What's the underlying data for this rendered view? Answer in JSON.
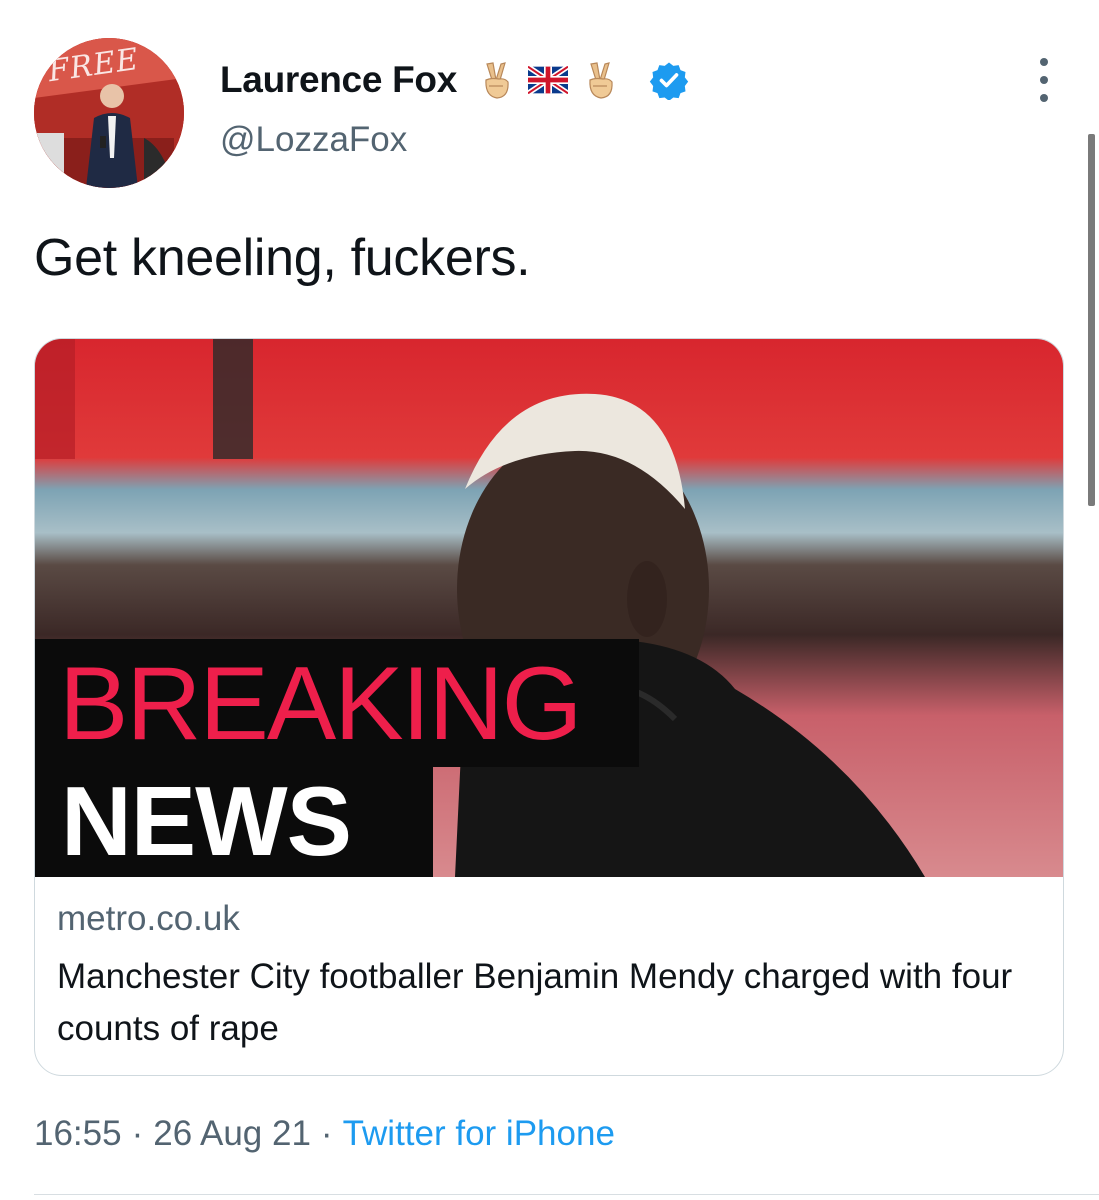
{
  "author": {
    "display_name": "Laurence Fox",
    "handle": "@LozzaFox",
    "avatar_caption": "FREE",
    "name_emojis": [
      "victory-hand-emoji",
      "union-jack-flag-emoji",
      "victory-hand-emoji"
    ],
    "verified_icon": "verified-badge-icon"
  },
  "tweet": {
    "text": "Get kneeling, fuckers."
  },
  "card": {
    "image_badge_line1": "BREAKING",
    "image_badge_line2": "NEWS",
    "domain": "metro.co.uk",
    "title": "Manchester City footballer Benjamin Mendy charged with four counts of rape"
  },
  "meta": {
    "time": "16:55",
    "separator": "·",
    "date": "26 Aug 21",
    "source": "Twitter for iPhone"
  },
  "colors": {
    "accent_blue": "#1d9bf0",
    "secondary_text": "#536471",
    "breaking_red": "#ee1f4b",
    "border": "#cfd9de"
  }
}
